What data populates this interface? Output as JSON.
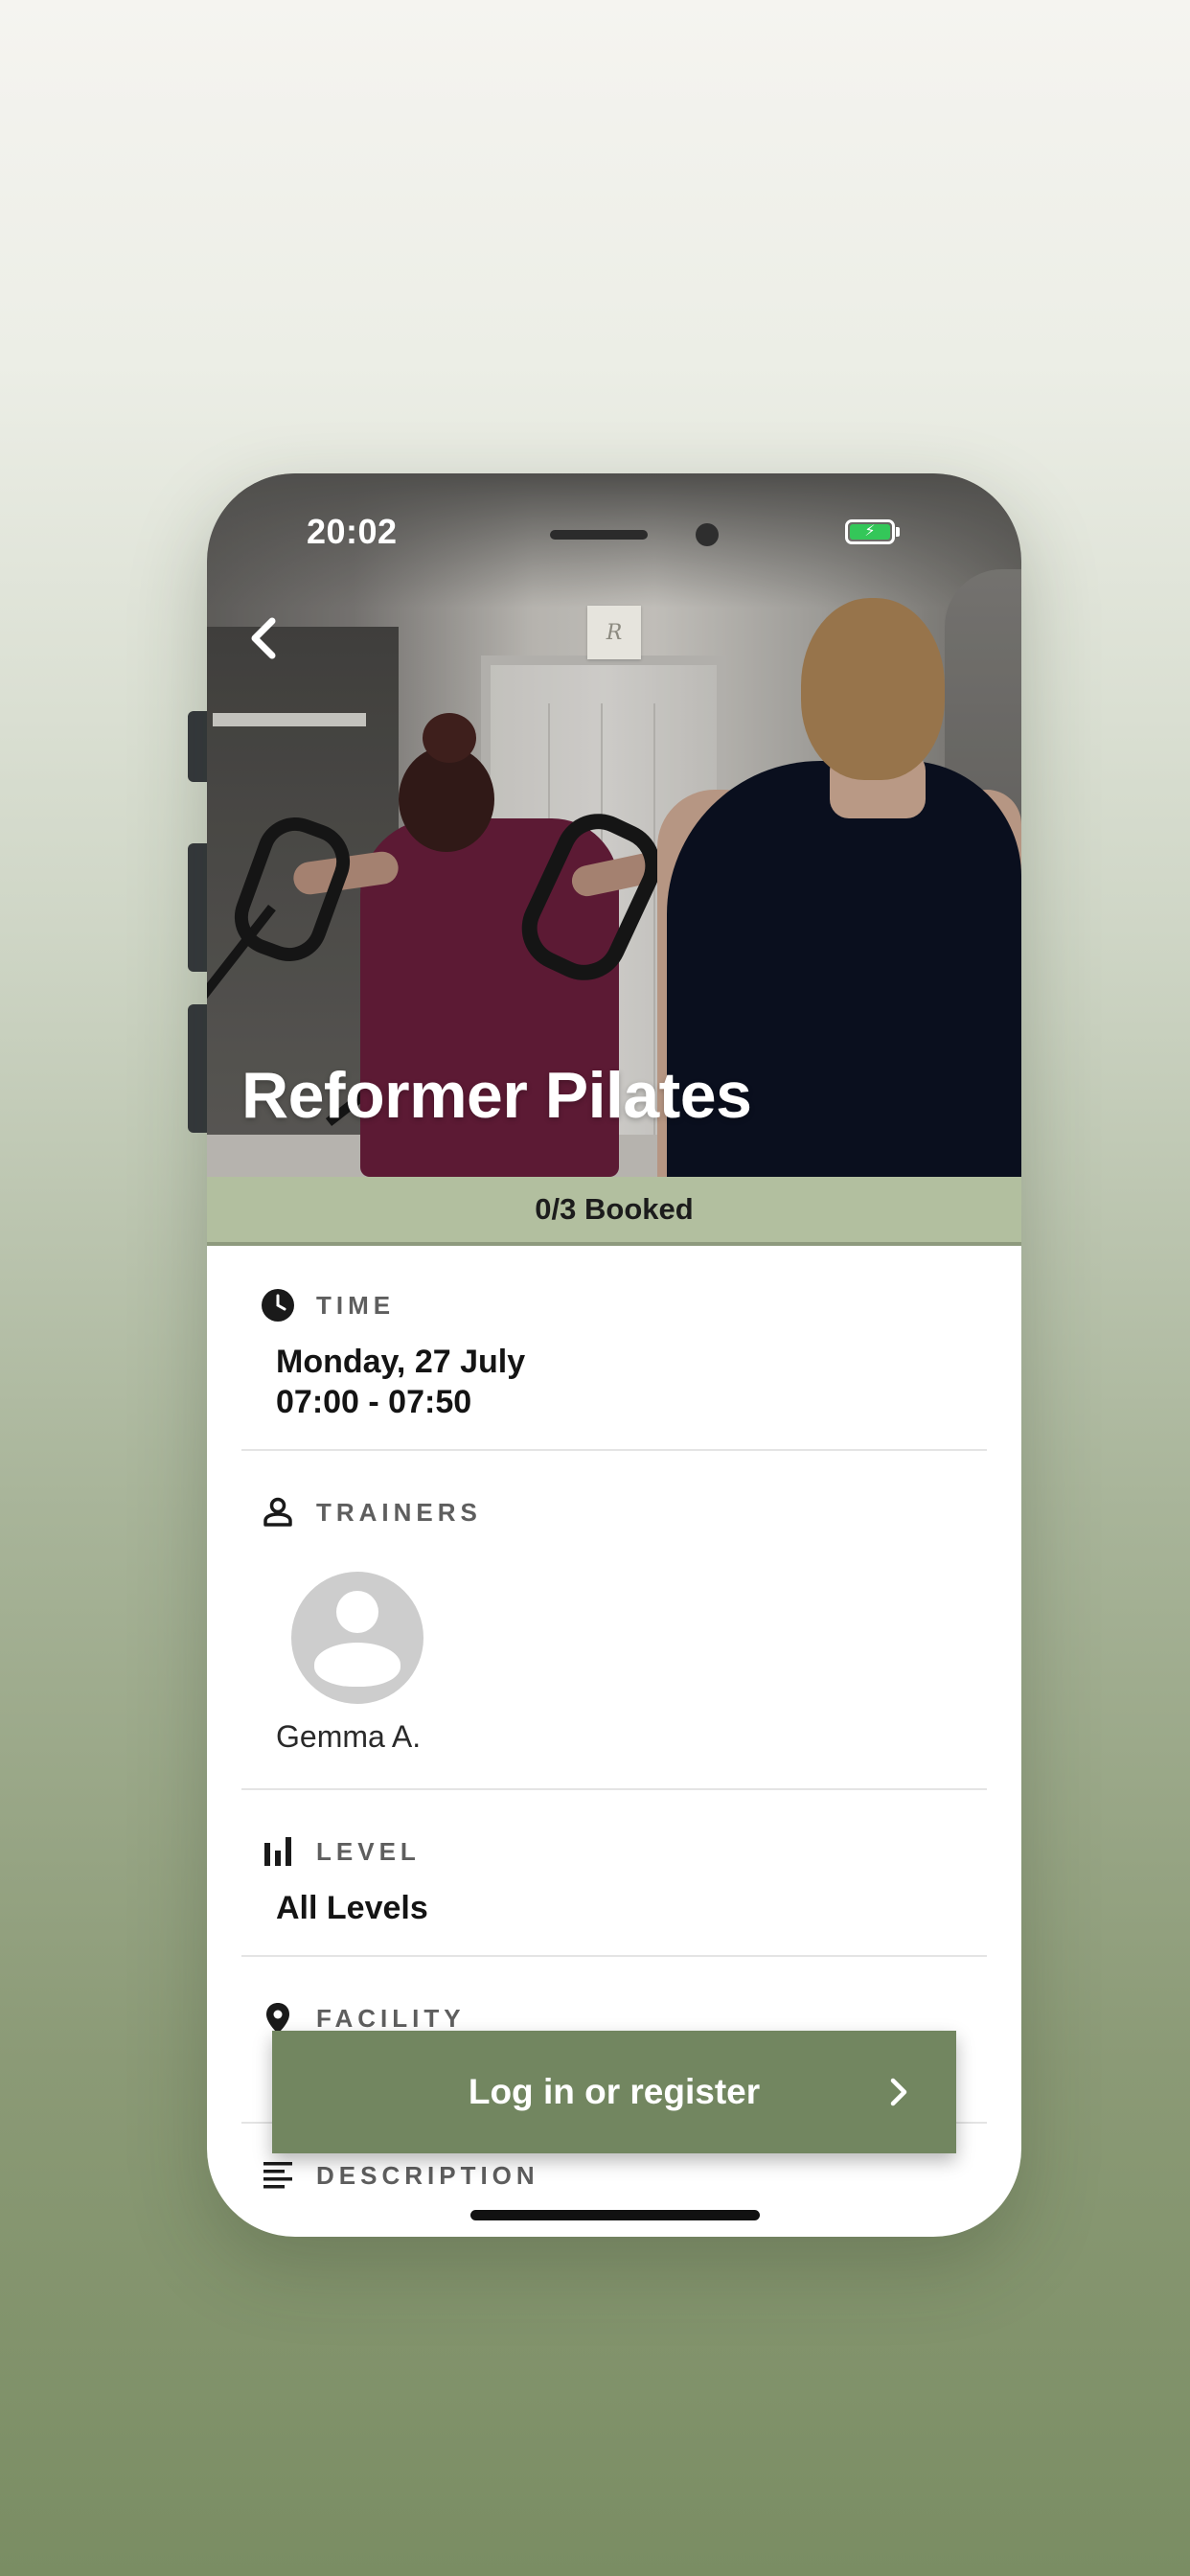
{
  "status_bar": {
    "time": "20:02",
    "battery_charging": true
  },
  "header": {
    "back_icon": "chevron-left-icon",
    "logo_text": "R"
  },
  "class": {
    "title": "Reformer Pilates",
    "booked": "0/3 Booked"
  },
  "sections": {
    "time": {
      "label": "TIME",
      "icon": "clock-icon",
      "date": "Monday, 27 July",
      "range": "07:00 - 07:50"
    },
    "trainers": {
      "label": "TRAINERS",
      "icon": "person-icon",
      "items": [
        {
          "name": "Gemma A."
        }
      ]
    },
    "level": {
      "label": "LEVEL",
      "icon": "bar-chart-icon",
      "value": "All Levels"
    },
    "facility": {
      "label": "FACILITY",
      "icon": "location-pin-icon"
    },
    "description": {
      "label": "DESCRIPTION",
      "icon": "text-lines-icon"
    }
  },
  "cta": {
    "label": "Log in or register",
    "icon": "chevron-right-icon"
  },
  "colors": {
    "accent": "#728660",
    "booked_bar": "#b2bf9f",
    "battery": "#34c759"
  }
}
